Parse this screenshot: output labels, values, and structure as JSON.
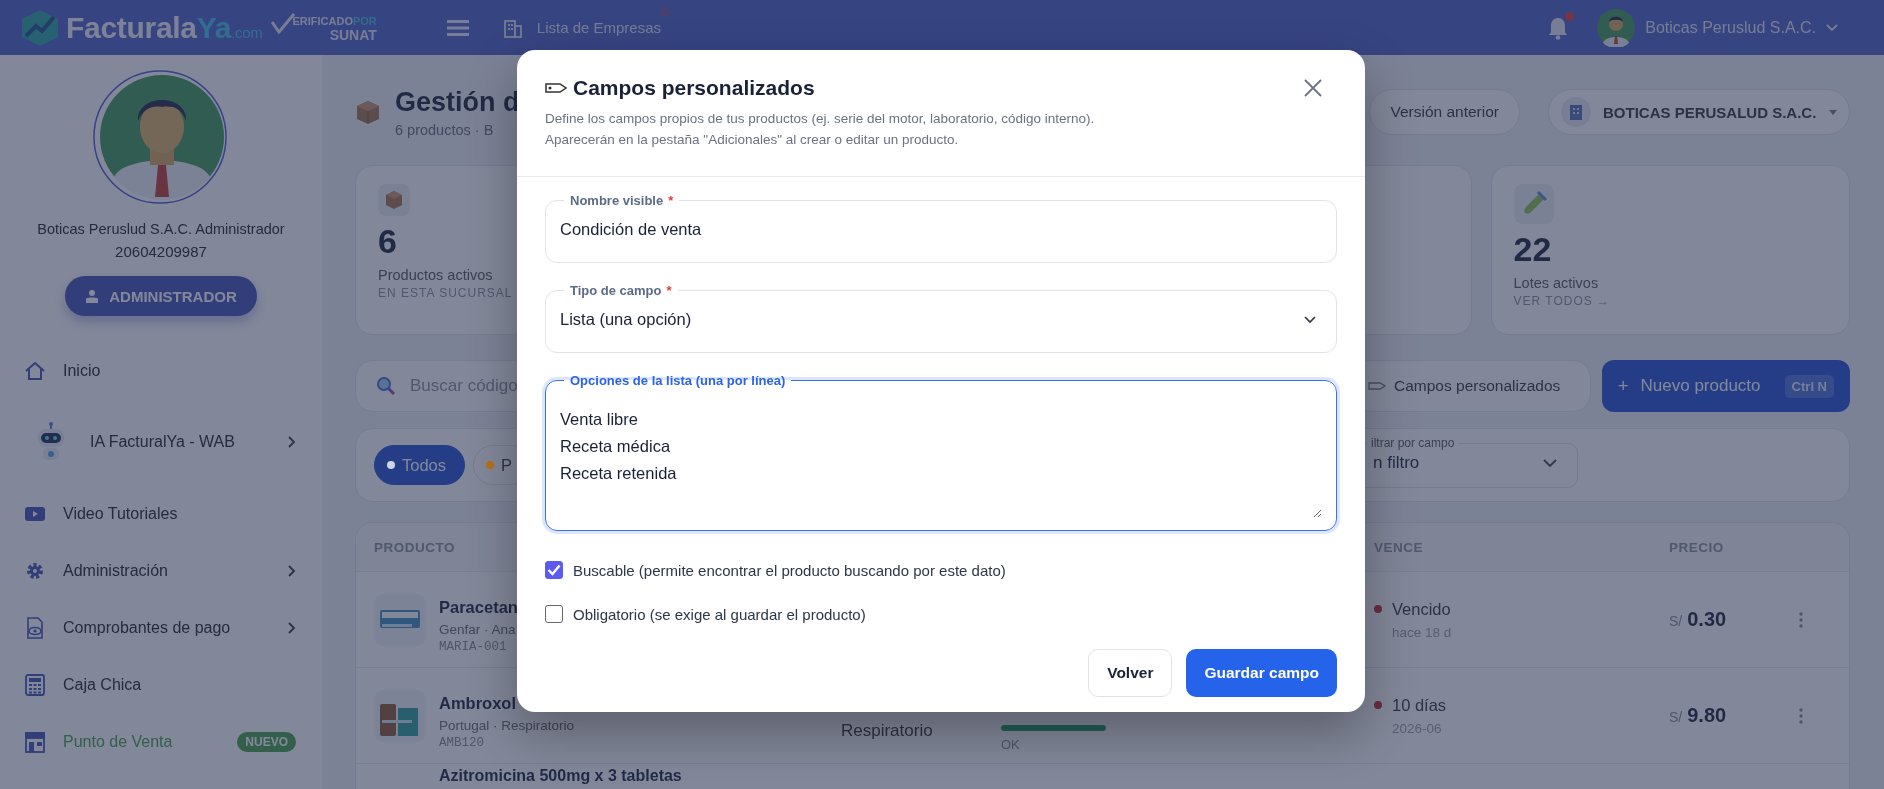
{
  "topbar": {
    "logo": {
      "main": "Facturala",
      "accent": "Ya",
      "suffix": ".com"
    },
    "verified": {
      "line1": "ERIFICADO",
      "line1_accent": "POR",
      "line2": "SUNAT"
    },
    "nav_link": "Lista de Empresas",
    "user_name": "Boticas Peruslud S.A.C."
  },
  "sidebar": {
    "profile_name": "Boticas Peruslud S.A.C. Administrador",
    "profile_id": "20604209987",
    "role_button": "ADMINISTRADOR",
    "items": [
      {
        "label": "Inicio",
        "has_submenu": false,
        "highlight": false
      },
      {
        "label": "IA FacturalYa - WAB",
        "has_submenu": true,
        "highlight": false
      },
      {
        "label": "Video Tutoriales",
        "has_submenu": false,
        "highlight": false
      },
      {
        "label": "Administración",
        "has_submenu": true,
        "highlight": false
      },
      {
        "label": "Comprobantes de pago",
        "has_submenu": true,
        "highlight": false
      },
      {
        "label": "Caja Chica",
        "has_submenu": false,
        "highlight": false
      },
      {
        "label": "Punto de Venta",
        "has_submenu": false,
        "highlight": true,
        "badge": "NUEVO"
      }
    ]
  },
  "header": {
    "title": "Gestión d",
    "subtitle": "6 productos · B",
    "old_version_button": "Versión anterior",
    "company_select": "BOTICAS PERUSALUD S.A.C."
  },
  "stats": [
    {
      "value": "6",
      "label": "Productos activos",
      "sub": "EN ESTA SUCURSAL"
    },
    {
      "value": "22",
      "label": "Lotes activos",
      "sub": "VER TODOS →"
    }
  ],
  "search": {
    "placeholder": "Buscar código"
  },
  "actions": {
    "custom_fields": "Campos personalizados",
    "new_product_icon": "+",
    "new_product": "Nuevo producto",
    "shortcut": "Ctrl N"
  },
  "filters": {
    "pills": [
      {
        "label": "Todos",
        "selected": true,
        "color": "#d0d4e4"
      },
      {
        "label": "P",
        "selected": false,
        "color": "#b86f1e"
      }
    ],
    "field_filter": {
      "label": "iltrar por campo",
      "value": "n filtro"
    }
  },
  "table": {
    "columns": [
      "PRODUCTO",
      "VENCE",
      "PRECIO"
    ],
    "rows": [
      {
        "name": "Paracetan",
        "meta": "Genfar · Ana",
        "code": "MARIA-001",
        "expiry": "Vencido",
        "expiry_sub": "hace 18 d",
        "currency": "S/",
        "price": "0.30"
      },
      {
        "name": "Ambroxol",
        "meta": "Portugal · Respiratorio",
        "code": "AMB120",
        "category": "Respiratorio",
        "stock": "OK",
        "expiry": "10 días",
        "expiry_sub": "2026-06",
        "currency": "S/",
        "price": "9.80"
      },
      {
        "name": "Azitromicina 500mg x 3 tabletas"
      }
    ]
  },
  "modal": {
    "title": "Campos personalizados",
    "description": [
      "Define los campos propios de tus productos (ej. serie del motor, laboratorio, código interno).",
      "Aparecerán en la pestaña \"Adicionales\" al crear o editar un producto."
    ],
    "fields": [
      {
        "kind": "text",
        "label": "Nombre visible",
        "required_mark": "*",
        "focused": false,
        "value": "Condición de venta"
      },
      {
        "kind": "select",
        "label": "Tipo de campo",
        "required_mark": "*",
        "focused": false,
        "value": "Lista (una opción)"
      },
      {
        "kind": "textarea",
        "label": "Opciones de la lista (una por línea)",
        "focused": true,
        "value": "Venta libre\nReceta médica\nReceta retenida"
      }
    ],
    "checkboxes": [
      {
        "label": "Buscable (permite encontrar el producto buscando por este dato)",
        "checked": true
      },
      {
        "label": "Obligatorio (se exige al guardar el producto)",
        "checked": false
      }
    ],
    "buttons": [
      {
        "label": "Volver",
        "kind": "secondary"
      },
      {
        "label": "Guardar campo",
        "kind": "primary"
      }
    ]
  }
}
